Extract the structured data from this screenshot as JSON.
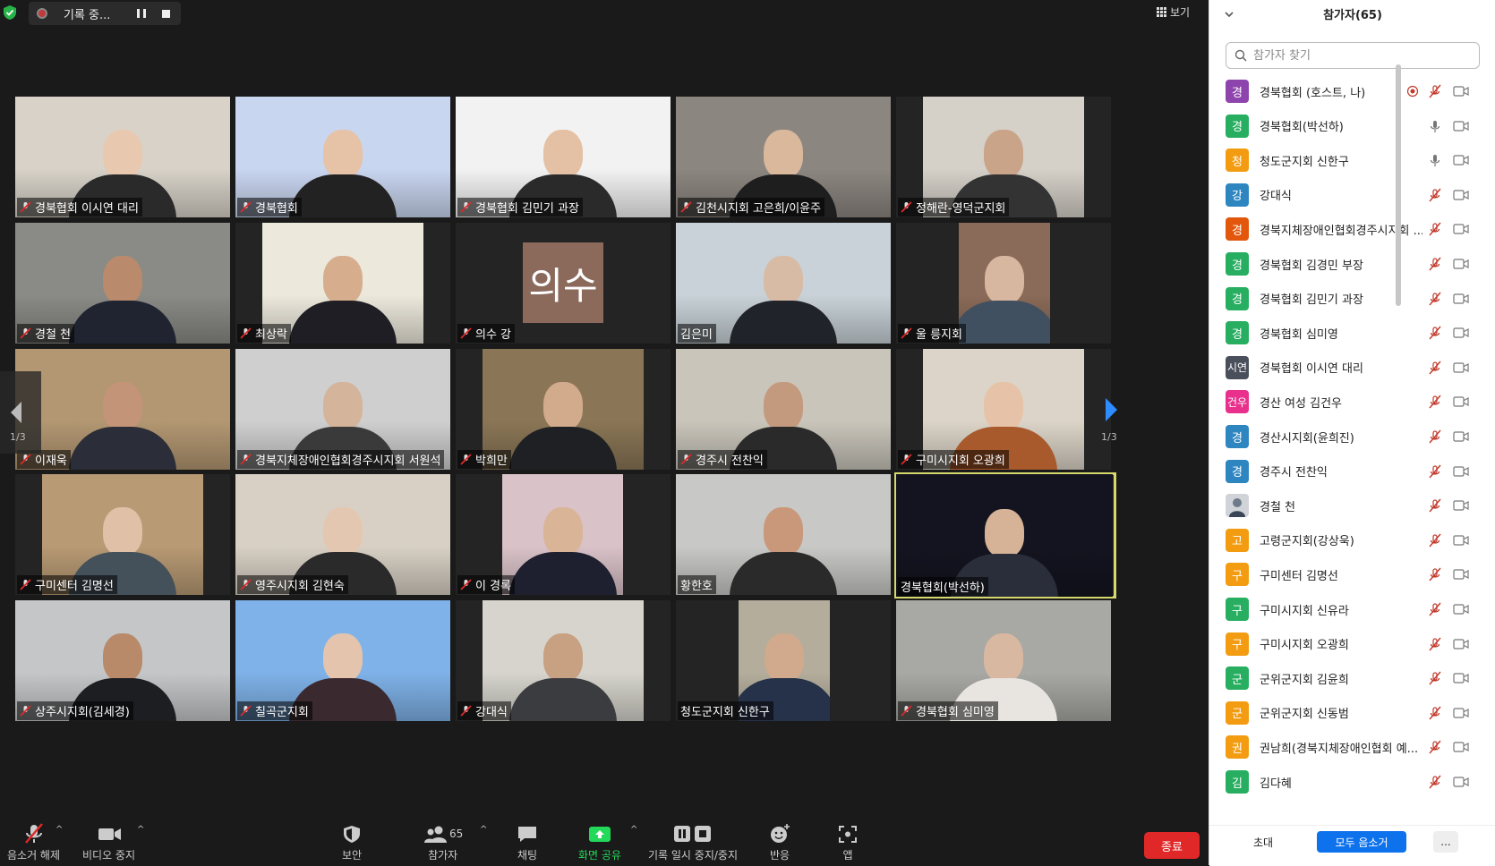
{
  "recording": {
    "status_text": "기록 중..."
  },
  "view_button": {
    "label": "보기"
  },
  "tiles": [
    {
      "name": "경북협회 이시연 대리",
      "bg": "#d8d2c8",
      "person": "#2a2a2a",
      "skin": "#e8c9b0"
    },
    {
      "name": "경북협회",
      "bg": "#c9d6f0",
      "person": "#222",
      "skin": "#e6c2a6"
    },
    {
      "name": "경북협회 김민기 과장",
      "bg": "#f2f2f2",
      "person": "#2a2a2a",
      "skin": "#e4c1a4"
    },
    {
      "name": "김천시지회 고은희/이윤주",
      "bg": "#8c8680",
      "person": "#1e1e1e",
      "skin": "#d9b89c"
    },
    {
      "name": "정해란-영덕군지회",
      "bg": "#d5d0c8",
      "person": "#333",
      "skin": "#c9a488"
    },
    {
      "name": "경철 천",
      "bg": "#8a8a86",
      "person": "#1f2430",
      "skin": "#b98a6c"
    },
    {
      "name": "최상락",
      "bg": "#ece8dc",
      "person": "#1e1e24",
      "skin": "#d6ae8e"
    },
    {
      "name": "의수 강",
      "avatar": "의수"
    },
    {
      "name": "김은미",
      "bg": "#c8d2d8",
      "person": "#20242a",
      "skin": "#d8bba5"
    },
    {
      "name": "울 릉지회",
      "bg": "#8a6a58",
      "person": "#405060",
      "skin": "#d7b7a0"
    },
    {
      "name": "이재욱",
      "bg": "#b39772",
      "person": "#2b2e38",
      "skin": "#c49478"
    },
    {
      "name": "경북지체장애인협회경주시지회 서원석",
      "bg": "#cfcfcf",
      "person": "#3a3a3a",
      "skin": "#d4b49a"
    },
    {
      "name": "박희만",
      "bg": "#8a7656",
      "person": "#1e2024",
      "skin": "#d2aa8c"
    },
    {
      "name": "경주시 전찬익",
      "bg": "#c9c5bb",
      "person": "#2a2a2a",
      "skin": "#c49a7e"
    },
    {
      "name": "구미시지회 오광희",
      "bg": "#dcd4c8",
      "person": "#a85a2c",
      "skin": "#e6c3a8"
    },
    {
      "name": "구미센터 김명선",
      "bg": "#b89a74",
      "person": "#44505a",
      "skin": "#e0c0a6"
    },
    {
      "name": "영주시지회 김현숙",
      "bg": "#d8d0c4",
      "person": "#2a2a2a",
      "skin": "#e4c7b0"
    },
    {
      "name": "이 경록",
      "bg": "#d9c2c8",
      "person": "#1e2030",
      "skin": "#d9b497"
    },
    {
      "name": "황한호",
      "bg": "#c8c8c6",
      "person": "#2a2a2a",
      "skin": "#c9987a"
    },
    {
      "name": "경북협회(박선하)",
      "bg": "#141420",
      "person": "#2a2e3a",
      "skin": "#d6b296"
    },
    {
      "name": "상주시지회(김세경)",
      "bg": "#c4c6c8",
      "person": "#1c1e22",
      "skin": "#b88a6a"
    },
    {
      "name": "칠곡군지회",
      "bg": "#7fb2e8",
      "person": "#3a2a30",
      "skin": "#e4c4ac"
    },
    {
      "name": "강대식",
      "bg": "#d6d4cc",
      "person": "#3a3c40",
      "skin": "#c8a082"
    },
    {
      "name": "청도군지회 신한구",
      "bg": "#b4ad9c",
      "person": "#26324a",
      "skin": "#d1a98c"
    },
    {
      "name": "경북협회 심미영",
      "bg": "#a8a8a4",
      "person": "#e8e4e0",
      "skin": "#d8b8a0"
    }
  ],
  "page_indicator": {
    "left": "1/3",
    "right": "1/3"
  },
  "toolbar": {
    "mute_label": "음소거 해제",
    "video_label": "비디오 중지",
    "security_label": "보안",
    "participants_label": "참가자",
    "participants_count": "65",
    "chat_label": "채팅",
    "share_label": "화면 공유",
    "record_label": "기록 일시 중지/중지",
    "reactions_label": "반응",
    "apps_label": "앱",
    "end_label": "종료"
  },
  "panel": {
    "title": "참가자(65)",
    "search_placeholder": "참가자 찾기",
    "participants": [
      {
        "avatar": "경",
        "color": "#8e44ad",
        "name": "경북협회 (호스트, 나)",
        "mic": "muted",
        "host": true
      },
      {
        "avatar": "경",
        "color": "#27ae60",
        "name": "경북협회(박선하)",
        "mic": "on"
      },
      {
        "avatar": "청",
        "color": "#f39c12",
        "name": "청도군지회 신한구",
        "mic": "on"
      },
      {
        "avatar": "강",
        "color": "#2e86c1",
        "name": "강대식",
        "mic": "muted"
      },
      {
        "avatar": "경",
        "color": "#e2570b",
        "name": "경북지체장애인협회경주시지회 ...",
        "mic": "muted"
      },
      {
        "avatar": "경",
        "color": "#27ae60",
        "name": "경북협회 김경민 부장",
        "mic": "muted"
      },
      {
        "avatar": "경",
        "color": "#27ae60",
        "name": "경북협회 김민기 과장",
        "mic": "muted"
      },
      {
        "avatar": "경",
        "color": "#27ae60",
        "name": "경북협회 심미영",
        "mic": "muted"
      },
      {
        "avatar": "시연",
        "color": "#4a4f5c",
        "name": "경북협회 이시연 대리",
        "mic": "muted"
      },
      {
        "avatar": "건우",
        "color": "#e8308c",
        "name": "경산 여성 김건우",
        "mic": "muted"
      },
      {
        "avatar": "경",
        "color": "#2e86c1",
        "name": "경산시지회(윤희진)",
        "mic": "muted"
      },
      {
        "avatar": "경",
        "color": "#2e86c1",
        "name": "경주시 전찬익",
        "mic": "muted"
      },
      {
        "avatar": "photo",
        "color": "#6c7a89",
        "name": "경철 천",
        "mic": "muted"
      },
      {
        "avatar": "고",
        "color": "#f39c12",
        "name": "고령군지회(강상욱)",
        "mic": "muted"
      },
      {
        "avatar": "구",
        "color": "#f39c12",
        "name": "구미센터 김명선",
        "mic": "muted"
      },
      {
        "avatar": "구",
        "color": "#27ae60",
        "name": "구미시지회 신유라",
        "mic": "muted"
      },
      {
        "avatar": "구",
        "color": "#f39c12",
        "name": "구미시지회 오광희",
        "mic": "muted"
      },
      {
        "avatar": "군",
        "color": "#27ae60",
        "name": "군위군지회 김윤희",
        "mic": "muted"
      },
      {
        "avatar": "군",
        "color": "#f39c12",
        "name": "군위군지회 신동범",
        "mic": "muted"
      },
      {
        "avatar": "권",
        "color": "#f39c12",
        "name": "권남희(경북지체장애인협회 예...",
        "mic": "muted"
      },
      {
        "avatar": "김",
        "color": "#27ae60",
        "name": "김다혜",
        "mic": "muted"
      }
    ],
    "invite_label": "초대",
    "mute_all_label": "모두 음소거",
    "more_label": "..."
  }
}
